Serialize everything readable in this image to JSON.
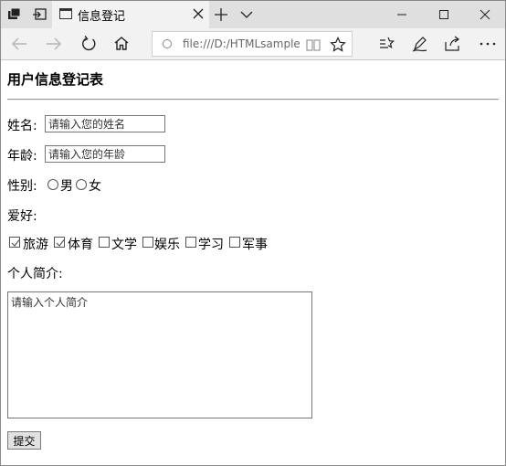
{
  "browser": {
    "tab_title": "信息登记",
    "address_url": "file:///D:/HTMLsample/reg"
  },
  "form": {
    "title": "用户信息登记表",
    "name_label": "姓名:",
    "name_placeholder": "请输入您的姓名",
    "age_label": "年龄:",
    "age_placeholder": "请输入您的年龄",
    "gender_label": "性别:",
    "gender_options": [
      "男",
      "女"
    ],
    "hobby_label": "爱好:",
    "hobbies": [
      {
        "label": "旅游",
        "checked": true
      },
      {
        "label": "体育",
        "checked": true
      },
      {
        "label": "文学",
        "checked": false
      },
      {
        "label": "娱乐",
        "checked": false
      },
      {
        "label": "学习",
        "checked": false
      },
      {
        "label": "军事",
        "checked": false
      }
    ],
    "intro_label": "个人简介:",
    "intro_placeholder": "请输入个人简介",
    "submit_label": "提交"
  }
}
